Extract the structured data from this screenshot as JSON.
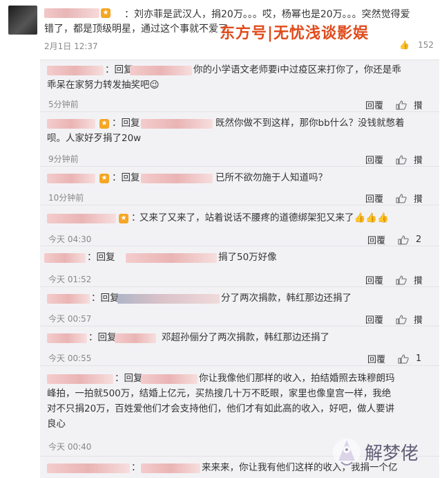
{
  "post": {
    "text": "：刘亦菲是武汉人，捐20万。。。哎，杨幂也是20万。。。突然觉得爱",
    "text2": "错了，都是顶级明星，通过这个事就不爱了",
    "time": "2月1日 12:37",
    "like_count": "152",
    "badge_icon": "vip-badge-icon"
  },
  "watermark": "东方号|无忧浅谈影娱",
  "replies": [
    {
      "prefix": "：回复",
      "text": "你的小学语文老师要i中过疫区来打你了，你还是乖",
      "text2": "乖呆在家努力转发抽奖吧😉",
      "time": "5分钟前",
      "reply": "回覆",
      "like_label": "攢",
      "count": ""
    },
    {
      "prefix": "：回复",
      "text": "既然你做不到这样，那你bb什么？没钱就憋着",
      "text2": "呗。人家好歹捐了20w",
      "time": "9分钟前",
      "reply": "回覆",
      "like_label": "攢",
      "count": ""
    },
    {
      "prefix": "：回复",
      "text": "已所不欲勿施于人知道吗？",
      "text2": "",
      "time": "10分钟前",
      "reply": "回覆",
      "like_label": "攢",
      "count": ""
    },
    {
      "prefix": "：",
      "text": "又来了又来了，站着说话不腰疼的道德绑架犯又来了👍👍👍",
      "text2": "",
      "time": "今天 04:30",
      "reply": "回覆",
      "like_label": "",
      "count": "2"
    },
    {
      "prefix": "：回复",
      "text": "捐了50万好像",
      "text2": "",
      "time": "今天 01:52",
      "reply": "回覆",
      "like_label": "攢",
      "count": ""
    },
    {
      "prefix": "：回复",
      "text": "分了两次捐款，韩红那边还捐了",
      "text2": "",
      "time": "今天 00:57",
      "reply": "回覆",
      "like_label": "攢",
      "count": ""
    },
    {
      "prefix": "：回复",
      "text": "邓超孙俪分了两次捐款，韩红那边还捐了",
      "text2": "",
      "time": "今天 00:55",
      "reply": "回覆",
      "like_label": "",
      "count": "1"
    },
    {
      "prefix": "：回复",
      "text": "你让我像他们那样的收入，拍结婚照去珠穆朗玛",
      "text2": "峰拍，一拍就500万，结婚上亿元，买热搜几十万不眨眼，家里也像皇宫一样，我绝",
      "text3": "对不只捐20万，百姓爱他们才会支持他们，他们才有如此高的收入，好吧，做人要讲",
      "text4": "良心",
      "time": "今天 00:40",
      "reply": "",
      "like_label": "",
      "count": ""
    },
    {
      "prefix": "：",
      "text": "来来来，你让我有他们这样的收入，我捐一个亿",
      "text2": "",
      "time": "",
      "reply": "",
      "like_label": "",
      "count": ""
    }
  ],
  "jiemeng_logo": "解梦佬"
}
